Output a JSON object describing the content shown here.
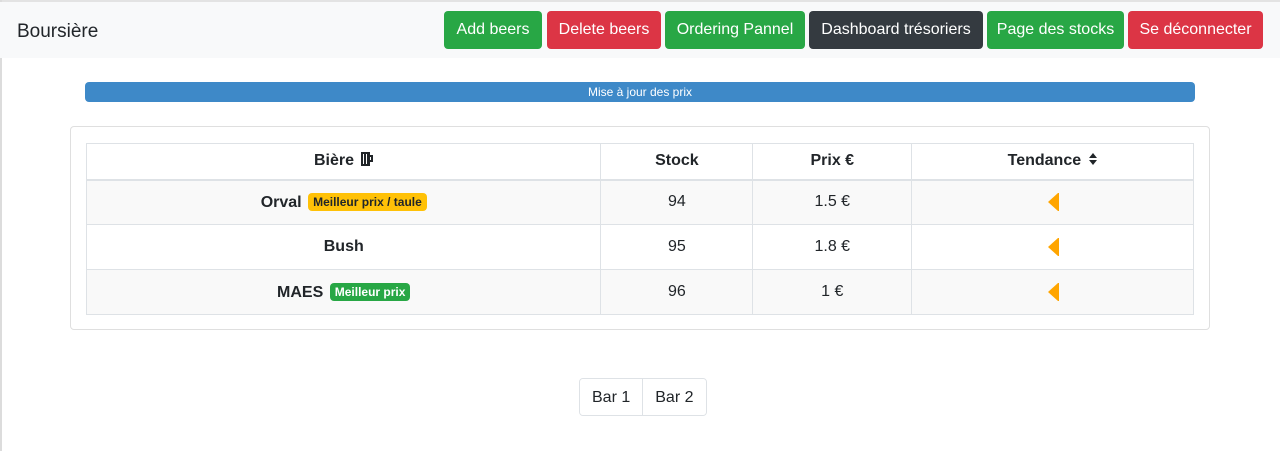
{
  "navbar": {
    "brand": "Boursière",
    "buttons": {
      "add": "Add beers",
      "delete": "Delete beers",
      "ordering": "Ordering Pannel",
      "dashboard": "Dashboard trésoriers",
      "stocks": "Page des stocks",
      "logout": "Se déconnecter"
    }
  },
  "progress": {
    "label": "Mise à jour des prix",
    "value_percent": 100,
    "color": "#3e89c8"
  },
  "table": {
    "headers": {
      "beer": "Bière",
      "stock": "Stock",
      "price": "Prix €",
      "trend": "Tendance"
    },
    "header_icons": {
      "beer": "beer-mug-icon",
      "trend": "sort-icon"
    },
    "rows": [
      {
        "name": "Orval",
        "badge": "Meilleur prix / taule",
        "badge_color": "#ffc107",
        "stock": "94",
        "price": "1.5 €",
        "trend": "down-left-arrow-icon",
        "trend_color": "#ffa500"
      },
      {
        "name": "Bush",
        "badge": "",
        "stock": "95",
        "price": "1.8 €",
        "trend": "down-left-arrow-icon",
        "trend_color": "#ffa500"
      },
      {
        "name": "MAES",
        "badge": "Meilleur prix",
        "badge_color": "#28a745",
        "stock": "96",
        "price": "1 €",
        "trend": "down-left-arrow-icon",
        "trend_color": "#ffa500"
      }
    ]
  },
  "pagination": {
    "items": [
      "Bar 1",
      "Bar 2"
    ]
  },
  "colors": {
    "success": "#28a745",
    "danger": "#dc3545",
    "dark": "#343a40",
    "warning": "#ffc107"
  }
}
